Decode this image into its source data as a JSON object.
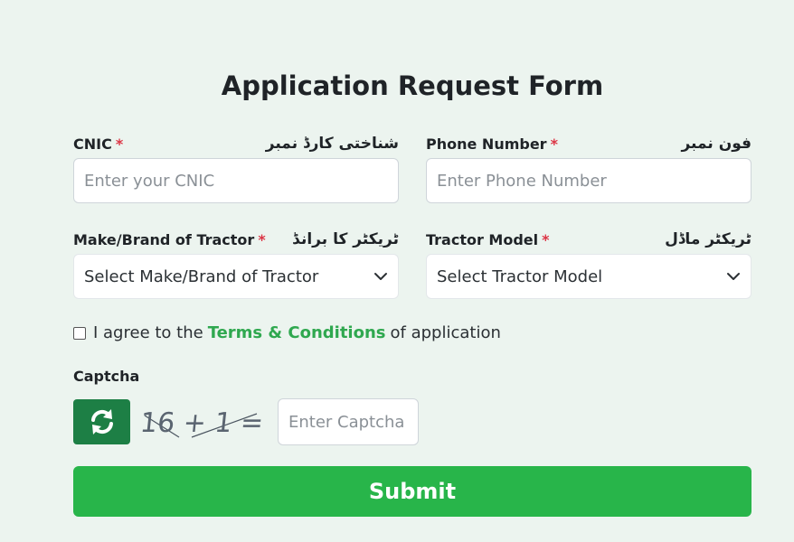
{
  "form": {
    "title": "Application Request Form"
  },
  "fields": {
    "cnic": {
      "label": "CNIC",
      "required": "*",
      "urdu_label": "شناختی کارڈ نمبر",
      "placeholder": "Enter your CNIC"
    },
    "phone": {
      "label": "Phone Number",
      "required": "*",
      "urdu_label": "فون نمبر",
      "placeholder": "Enter Phone Number"
    },
    "make": {
      "label": "Make/Brand of Tractor",
      "required": "*",
      "urdu_label": "ٹریکٹر کا برانڈ",
      "selected": "Select Make/Brand of Tractor"
    },
    "model": {
      "label": "Tractor Model",
      "required": "*",
      "urdu_label": "ٹریکٹر ماڈل",
      "selected": "Select Tractor Model"
    }
  },
  "agreement": {
    "checked": false,
    "prefix": "I agree to the",
    "link": "Terms & Conditions",
    "suffix": "of application"
  },
  "captcha": {
    "label": "Captcha",
    "challenge": "16 + 1 =",
    "placeholder": "Enter Captcha",
    "refresh_icon": "refresh-icon"
  },
  "submit": {
    "label": "Submit"
  },
  "colors": {
    "background": "#ecf4ef",
    "accent": "#28b54a",
    "refresh": "#1d7f45",
    "link": "#2fa84f",
    "required": "#dc3545"
  }
}
